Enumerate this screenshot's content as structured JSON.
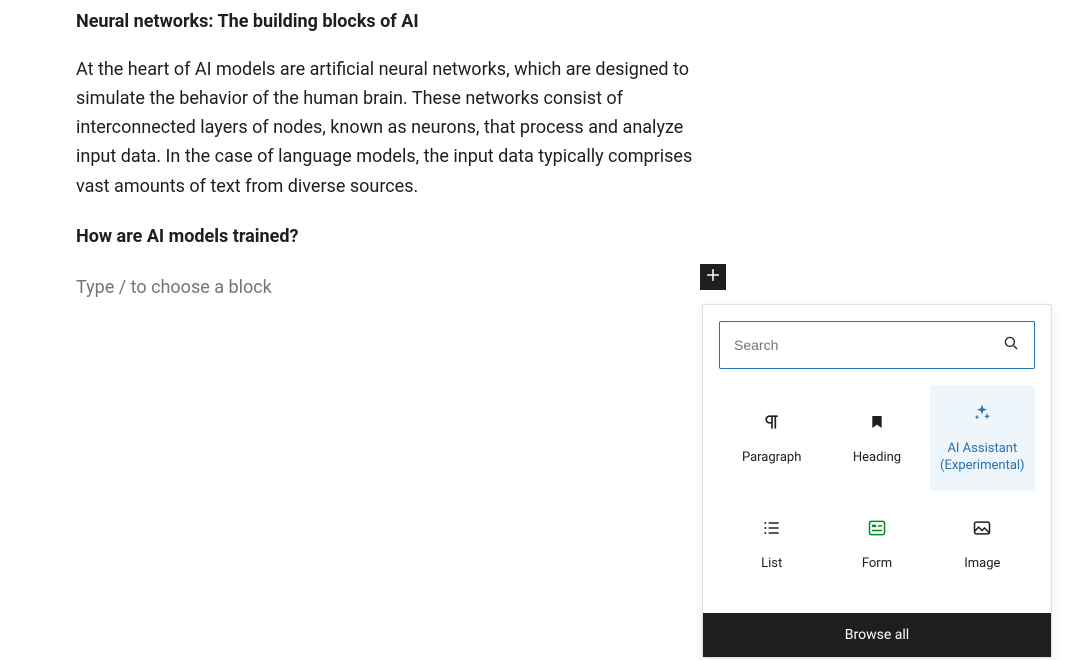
{
  "content": {
    "heading1": "Neural networks: The building blocks of AI",
    "para1": "At the heart of AI models are artificial neural networks, which are designed to simulate the behavior of the human brain. These networks consist of interconnected layers of nodes, known as neurons, that process and analyze input data. In the case of language models, the input data typically comprises vast amounts of text from diverse sources.",
    "heading2": "How are AI models trained?",
    "block_placeholder": "Type / to choose a block"
  },
  "inserter": {
    "search_placeholder": "Search",
    "blocks": {
      "paragraph": "Paragraph",
      "heading": "Heading",
      "ai_assistant": "AI Assistant (Experimental)",
      "list": "List",
      "form": "Form",
      "image": "Image"
    },
    "browse_all": "Browse all"
  }
}
